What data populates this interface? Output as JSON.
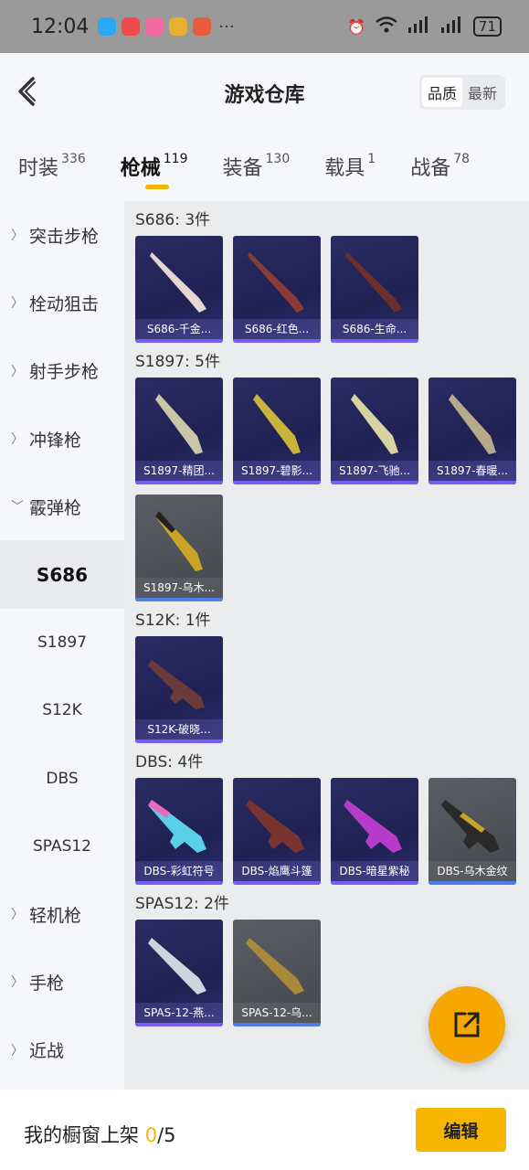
{
  "status_bar": {
    "time": "12:04",
    "battery": "71",
    "signal_label": "4G",
    "wifi_label": "6",
    "more": "···"
  },
  "header": {
    "title": "游戏仓库",
    "sort_options": [
      "品质",
      "最新"
    ]
  },
  "tabs": [
    {
      "label": "时装",
      "count": "336"
    },
    {
      "label": "枪械",
      "count": "119"
    },
    {
      "label": "装备",
      "count": "130"
    },
    {
      "label": "载具",
      "count": "1"
    },
    {
      "label": "战备",
      "count": "78"
    }
  ],
  "sidebar": {
    "items": [
      "突击步枪",
      "栓动狙击",
      "射手步枪",
      "冲锋枪",
      "霰弹枪"
    ],
    "subs": [
      "S686",
      "S1897",
      "S12K",
      "DBS",
      "SPAS12"
    ],
    "items_after": [
      "轻机枪",
      "手枪",
      "近战"
    ]
  },
  "groups": [
    {
      "title": "S686: 3件",
      "items": [
        {
          "name": "S686-千金...",
          "tier": "purple"
        },
        {
          "name": "S686-红色...",
          "tier": "purple"
        },
        {
          "name": "S686-生命...",
          "tier": "purple"
        }
      ]
    },
    {
      "title": "S1897: 5件",
      "items": [
        {
          "name": "S1897-精团...",
          "tier": "purple"
        },
        {
          "name": "S1897-碧影...",
          "tier": "purple"
        },
        {
          "name": "S1897-飞驰...",
          "tier": "purple"
        },
        {
          "name": "S1897-春暖...",
          "tier": "purple"
        },
        {
          "name": "S1897-乌木...",
          "tier": "gray"
        }
      ]
    },
    {
      "title": "S12K: 1件",
      "items": [
        {
          "name": "S12K-破晓...",
          "tier": "purple"
        }
      ]
    },
    {
      "title": "DBS: 4件",
      "items": [
        {
          "name": "DBS-彩虹符号",
          "tier": "purple"
        },
        {
          "name": "DBS-焰鹰斗篷",
          "tier": "purple"
        },
        {
          "name": "DBS-暗星紫秘",
          "tier": "purple"
        },
        {
          "name": "DBS-乌木金纹",
          "tier": "gray"
        }
      ]
    },
    {
      "title": "SPAS12: 2件",
      "items": [
        {
          "name": "SPAS-12-燕...",
          "tier": "purple"
        },
        {
          "name": "SPAS-12-乌...",
          "tier": "gray"
        }
      ]
    }
  ],
  "bottom": {
    "label": "我的橱窗上架 ",
    "current": "0",
    "total": "/5",
    "edit_label": "编辑"
  },
  "colors": {
    "accent": "#f5b400",
    "card_purple": "#23265a",
    "card_gray": "#4c4f55"
  }
}
